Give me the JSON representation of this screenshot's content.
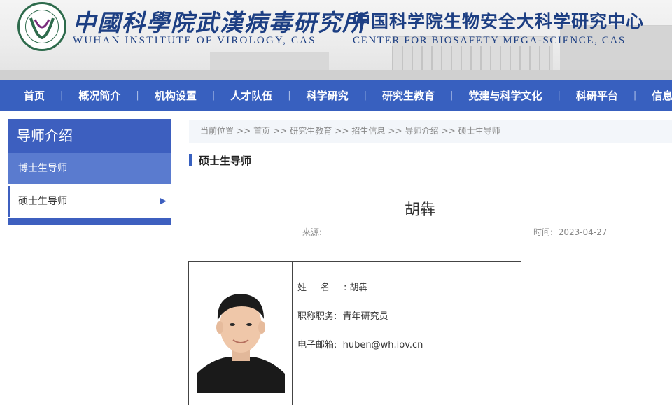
{
  "header": {
    "institute_cn": "中國科學院武漢病毒研究所",
    "institute_en": "WUHAN INSTITUTE OF VIROLOGY, CAS",
    "center_cn": "中国科学院生物安全大科学研究中心",
    "center_en": "CENTER FOR BIOSAFETY MEGA-SCIENCE, CAS",
    "logo_icon": "institute-seal-icon"
  },
  "nav": {
    "items": [
      "首页",
      "概况简介",
      "机构设置",
      "人才队伍",
      "科学研究",
      "研究生教育",
      "党建与科学文化",
      "科研平台",
      "信息公开"
    ],
    "separator": "|"
  },
  "sidebar": {
    "title": "导师介绍",
    "items": [
      {
        "label": "博士生导师"
      },
      {
        "label": "硕士生导师"
      }
    ]
  },
  "breadcrumb": {
    "prefix": "当前位置",
    "separator": ">>",
    "items": [
      "首页",
      "研究生教育",
      "招生信息",
      "导师介绍",
      "硕士生导师"
    ]
  },
  "section": {
    "title": "硕士生导师"
  },
  "article": {
    "title": "胡犇",
    "source_label": "来源:",
    "time_label": "时间:",
    "date": "2023-04-27"
  },
  "profile": {
    "name_label": "姓名:",
    "name": "胡犇",
    "title_label": "职称职务:",
    "title": "青年研究员",
    "email_label": "电子邮箱:",
    "email": "huben@wh.iov.cn"
  },
  "colors": {
    "nav_bg": "#3860bf",
    "sidebar_head": "#3d5fbf",
    "sidebar_item": "#5a7bcf",
    "brand_text": "#1d3f83"
  }
}
